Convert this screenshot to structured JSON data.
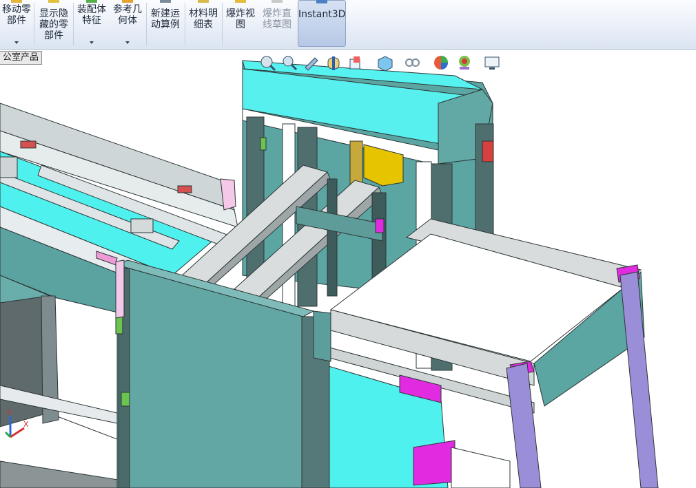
{
  "ribbon": {
    "buttons": [
      {
        "id": "move-component",
        "label": "移动零\n部件",
        "dropdown": true
      },
      {
        "id": "show-hidden",
        "label": "显示隐\n藏的零\n部件",
        "dropdown": false
      },
      {
        "id": "assembly-features",
        "label": "装配体\n特征",
        "dropdown": true
      },
      {
        "id": "reference-geometry",
        "label": "参考几\n何体",
        "dropdown": true
      },
      {
        "id": "new-motion-study",
        "label": "新建运\n动算例",
        "dropdown": false
      },
      {
        "id": "bill-of-materials",
        "label": "材料明\n细表",
        "dropdown": false
      },
      {
        "id": "exploded-view",
        "label": "爆炸视\n图",
        "dropdown": false
      },
      {
        "id": "explode-line-sketch",
        "label": "爆炸直\n线草图",
        "dropdown": false
      },
      {
        "id": "instant3d",
        "label": "Instant3D",
        "dropdown": false
      }
    ]
  },
  "document": {
    "name_fragment": "公室产品"
  },
  "heads_up_toolbar": {
    "icons": [
      "zoom-to-fit-icon",
      "zoom-to-area-icon",
      "previous-view-icon",
      "section-view-icon",
      "view-orientation-icon",
      "display-style-icon",
      "hide-show-items-icon",
      "edit-appearance-icon",
      "apply-scene-icon",
      "view-settings-icon"
    ]
  },
  "triad": {
    "x_label": "X",
    "y_label": "Y"
  },
  "colors": {
    "body_teal": "#62a7a4",
    "cyan_plate": "#4ff1ef",
    "rail_gray": "#d7dbdc",
    "magenta": "#e02be0",
    "lavender": "#9a8ed8",
    "yellow_motor": "#e6c400"
  }
}
